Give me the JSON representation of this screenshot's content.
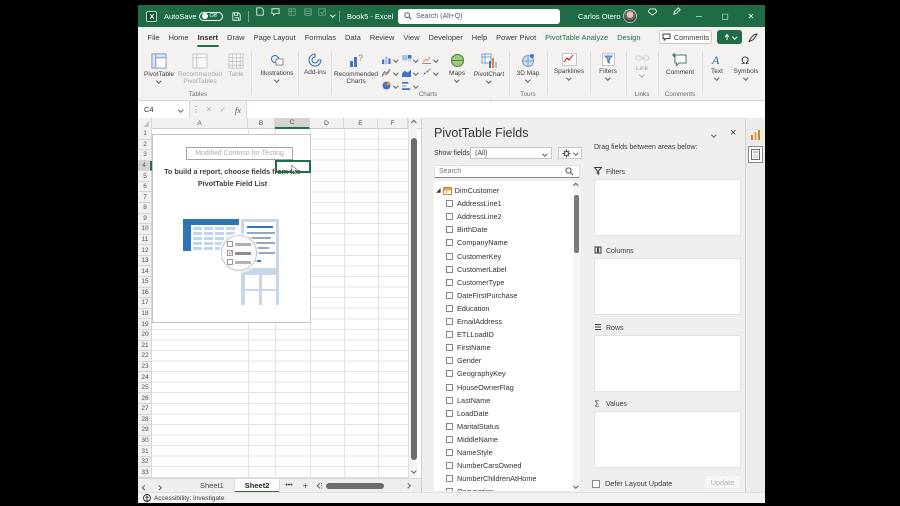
{
  "titlebar": {
    "autosave_label": "AutoSave",
    "autosave_state": "Off",
    "workbook_title": "Book5 - Excel",
    "search_placeholder": "Search (Alt+Q)",
    "user_name": "Carlos Otero"
  },
  "ribbon_tabs": [
    {
      "label": "File",
      "state": "normal"
    },
    {
      "label": "Home",
      "state": "normal"
    },
    {
      "label": "Insert",
      "state": "active"
    },
    {
      "label": "Draw",
      "state": "normal"
    },
    {
      "label": "Page Layout",
      "state": "normal"
    },
    {
      "label": "Formulas",
      "state": "normal"
    },
    {
      "label": "Data",
      "state": "normal"
    },
    {
      "label": "Review",
      "state": "normal"
    },
    {
      "label": "View",
      "state": "normal"
    },
    {
      "label": "Developer",
      "state": "normal"
    },
    {
      "label": "Help",
      "state": "normal"
    },
    {
      "label": "Power Pivot",
      "state": "normal"
    },
    {
      "label": "PivotTable Analyze",
      "state": "contextual"
    },
    {
      "label": "Design",
      "state": "contextual"
    }
  ],
  "tabrow_buttons": {
    "comments": "Comments"
  },
  "ribbon": {
    "buttons": {
      "pivottable": "PivotTable",
      "recommended_pivottables": "Recommended PivotTables",
      "table": "Table",
      "illustrations": "Illustrations",
      "addins": "Add-ins",
      "recommended_charts": "Recommended Charts",
      "maps": "Maps",
      "pivotchart": "PivotChart",
      "map3d": "3D Map",
      "sparklines": "Sparklines",
      "filters": "Filters",
      "link": "Link",
      "comment": "Comment",
      "text": "Text",
      "symbols": "Symbols"
    },
    "group_labels": {
      "tables": "Tables",
      "charts": "Charts",
      "tours": "Tours",
      "links": "Links",
      "comments": "Comments"
    }
  },
  "formula_bar": {
    "name_box": "C4",
    "fx": "fx"
  },
  "grid": {
    "columns": [
      "A",
      "B",
      "C",
      "D",
      "E",
      "F"
    ],
    "rows": [
      1,
      2,
      3,
      4,
      5,
      6,
      7,
      8,
      9,
      10,
      11,
      12,
      13,
      14,
      15,
      16,
      17,
      18,
      19,
      20,
      21,
      22,
      23,
      24,
      25,
      26,
      27,
      28,
      29,
      30,
      31,
      32,
      33
    ],
    "selected_cell": "C4"
  },
  "placeholder": {
    "title_value": "Modified Contoso for Testing",
    "line1": "To build a report, choose fields from the",
    "line2": "PivotTable Field List"
  },
  "fields_pane": {
    "title": "PivotTable Fields",
    "show_fields_label": "Show fields:",
    "show_fields_value": "(All)",
    "search_placeholder": "Search",
    "table_name": "DimCustomer",
    "fields": [
      "AddressLine1",
      "AddressLine2",
      "BirthDate",
      "CompanyName",
      "CustomerKey",
      "CustomerLabel",
      "CustomerType",
      "DateFirstPurchase",
      "Education",
      "EmailAddress",
      "ETLLoadID",
      "FirstName",
      "Gender",
      "GeographyKey",
      "HouseOwnerFlag",
      "LastName",
      "LoadDate",
      "MaritalStatus",
      "MiddleName",
      "NameStyle",
      "NumberCarsOwned",
      "NumberChildrenAtHome",
      "Occupation"
    ],
    "drag_hint": "Drag fields between areas below:",
    "areas": [
      {
        "name": "Filters",
        "icon": "filter-icon"
      },
      {
        "name": "Columns",
        "icon": "columns-icon"
      },
      {
        "name": "Rows",
        "icon": "rows-icon"
      },
      {
        "name": "Values",
        "icon": "values-icon"
      }
    ],
    "defer_label": "Defer Layout Update",
    "update_label": "Update"
  },
  "sheet_tabs": {
    "tabs": [
      {
        "label": "Sheet1",
        "active": false
      },
      {
        "label": "Sheet2",
        "active": true
      }
    ]
  },
  "status_bar": {
    "text": "Accessibility: Investigate"
  }
}
